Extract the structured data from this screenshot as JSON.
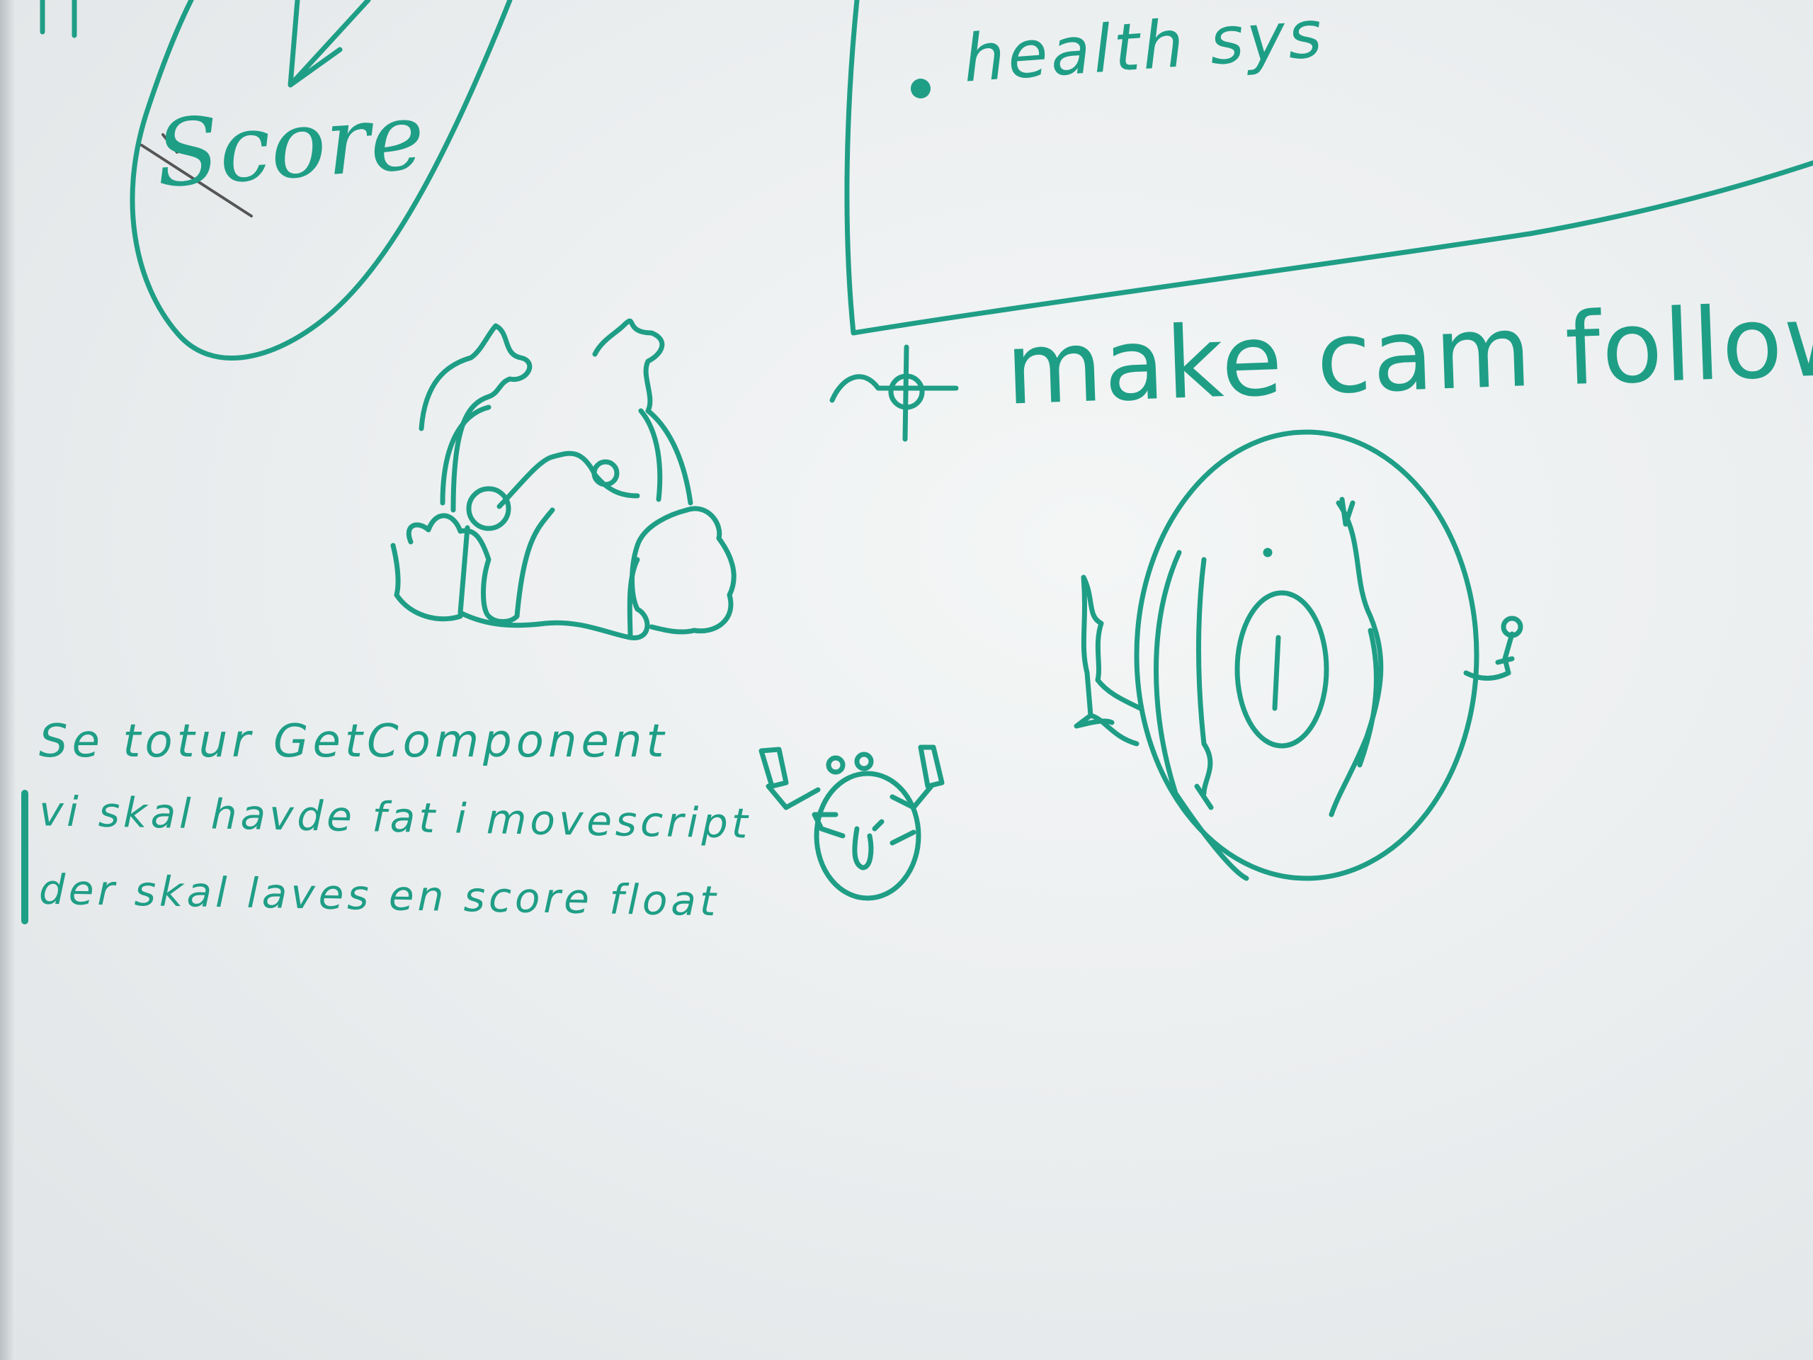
{
  "ink_color": "#1f9e86",
  "board_color": "#eceff0",
  "notes": {
    "score": "Score",
    "health": "health sys",
    "make_cam": "make cam followh",
    "line1": "Se totur  GetComponent",
    "line2": "vi skal havde fat i movescript",
    "line3": "der skal laves en score float"
  }
}
